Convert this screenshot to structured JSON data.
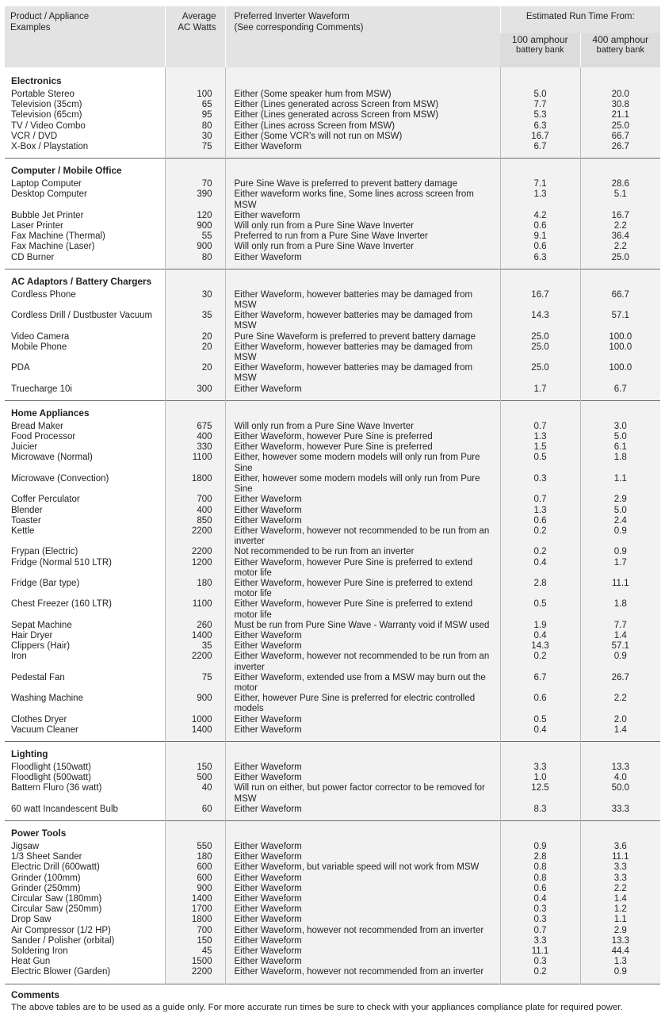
{
  "header": {
    "col_name_line1": "Product / Appliance",
    "col_name_line2": "Examples",
    "col_watts_line1": "Average",
    "col_watts_line2": "AC Watts",
    "col_wave_line1": "Preferred Inverter Waveform",
    "col_wave_line2": "(See corresponding Comments)",
    "runtime_group": "Estimated Run Time From:",
    "runtime_100_line1": "100 amphour",
    "runtime_100_line2": "battery bank",
    "runtime_400_line1": "400 amphour",
    "runtime_400_line2": "battery bank"
  },
  "comments": {
    "title": "Comments",
    "body": "The above tables are to be used as a guide only. For more accurate run times be sure to check with your appliances compliance plate for required power."
  },
  "chart_data": {
    "type": "table",
    "title": "Product / Appliance Examples",
    "columns": [
      "Product / Appliance Examples",
      "Average AC Watts",
      "Preferred Inverter Waveform (See corresponding Comments)",
      "100 amphour battery bank",
      "400 amphour battery bank"
    ],
    "sections": [
      {
        "name": "Electronics",
        "rows": [
          {
            "name": "Portable Stereo",
            "watts": "100",
            "waveform": "Either (Some speaker hum from MSW)",
            "r100": "5.0",
            "r400": "20.0"
          },
          {
            "name": "Television (35cm)",
            "watts": "65",
            "waveform": "Either (Lines generated across Screen from MSW)",
            "r100": "7.7",
            "r400": "30.8"
          },
          {
            "name": "Television (65cm)",
            "watts": "95",
            "waveform": "Either (Lines generated across Screen from MSW)",
            "r100": "5.3",
            "r400": "21.1"
          },
          {
            "name": "TV / Video Combo",
            "watts": "80",
            "waveform": "Either (Lines across Screen from MSW)",
            "r100": "6.3",
            "r400": "25.0"
          },
          {
            "name": "VCR / DVD",
            "watts": "30",
            "waveform": "Either (Some VCR's will not run on MSW)",
            "r100": "16.7",
            "r400": "66.7"
          },
          {
            "name": "X-Box / Playstation",
            "watts": "75",
            "waveform": "Either Waveform",
            "r100": "6.7",
            "r400": "26.7"
          }
        ]
      },
      {
        "name": "Computer / Mobile Office",
        "rows": [
          {
            "name": "Laptop Computer",
            "watts": "70",
            "waveform": "Pure Sine Wave is preferred to prevent battery damage",
            "r100": "7.1",
            "r400": "28.6"
          },
          {
            "name": "Desktop Computer",
            "watts": "390",
            "waveform": "Either waveform works fine, Some lines across screen from MSW",
            "r100": "1.3",
            "r400": "5.1"
          },
          {
            "name": "Bubble Jet Printer",
            "watts": "120",
            "waveform": "Either waveform",
            "r100": "4.2",
            "r400": "16.7"
          },
          {
            "name": "Laser Printer",
            "watts": "900",
            "waveform": "Will only run from a Pure Sine Wave Inverter",
            "r100": "0.6",
            "r400": "2.2"
          },
          {
            "name": "Fax Machine (Thermal)",
            "watts": "55",
            "waveform": "Preferred to run from a Pure Sine Wave Inverter",
            "r100": "9.1",
            "r400": "36.4"
          },
          {
            "name": "Fax Machine (Laser)",
            "watts": "900",
            "waveform": "Will only run from a Pure Sine Wave Inverter",
            "r100": "0.6",
            "r400": "2.2"
          },
          {
            "name": "CD Burner",
            "watts": "80",
            "waveform": "Either Waveform",
            "r100": "6.3",
            "r400": "25.0"
          }
        ]
      },
      {
        "name": "AC Adaptors / Battery Chargers",
        "rows": [
          {
            "name": "Cordless Phone",
            "watts": "30",
            "waveform": "Either Waveform, however batteries may be damaged from MSW",
            "r100": "16.7",
            "r400": "66.7"
          },
          {
            "name": "Cordless Drill / Dustbuster Vacuum",
            "watts": "35",
            "waveform": "Either Waveform, however batteries may be damaged from MSW",
            "r100": "14.3",
            "r400": "57.1"
          },
          {
            "name": "Video Camera",
            "watts": "20",
            "waveform": "Pure Sine Waveform is preferred to prevent battery damage",
            "r100": "25.0",
            "r400": "100.0"
          },
          {
            "name": "Mobile Phone",
            "watts": "20",
            "waveform": "Either Waveform, however batteries may be damaged from MSW",
            "r100": "25.0",
            "r400": "100.0"
          },
          {
            "name": "PDA",
            "watts": "20",
            "waveform": "Either Waveform, however batteries may be damaged from MSW",
            "r100": "25.0",
            "r400": "100.0"
          },
          {
            "name": "Truecharge 10i",
            "watts": "300",
            "waveform": "Either Waveform",
            "r100": "1.7",
            "r400": "6.7"
          }
        ]
      },
      {
        "name": "Home Appliances",
        "rows": [
          {
            "name": "Bread Maker",
            "watts": "675",
            "waveform": "Will only run from a Pure Sine Wave Inverter",
            "r100": "0.7",
            "r400": "3.0"
          },
          {
            "name": "Food Processor",
            "watts": "400",
            "waveform": "Either Waveform, however Pure Sine is preferred",
            "r100": "1.3",
            "r400": "5.0"
          },
          {
            "name": "Juicier",
            "watts": "330",
            "waveform": "Either Waveform, however Pure Sine is preferred",
            "r100": "1.5",
            "r400": "6.1"
          },
          {
            "name": "Microwave (Normal)",
            "watts": "1100",
            "waveform": "Either, however some modern models will only run from Pure Sine",
            "r100": "0.5",
            "r400": "1.8"
          },
          {
            "name": "Microwave (Convection)",
            "watts": "1800",
            "waveform": "Either, however some modern models will only run from Pure Sine",
            "r100": "0.3",
            "r400": "1.1"
          },
          {
            "name": "Coffer Perculator",
            "watts": "700",
            "waveform": "Either Waveform",
            "r100": "0.7",
            "r400": "2.9"
          },
          {
            "name": "Blender",
            "watts": "400",
            "waveform": "Either Waveform",
            "r100": "1.3",
            "r400": "5.0"
          },
          {
            "name": "Toaster",
            "watts": "850",
            "waveform": "Either Waveform",
            "r100": "0.6",
            "r400": "2.4"
          },
          {
            "name": "Kettle",
            "watts": "2200",
            "waveform": "Either Waveform, however not recommended to be run from an inverter",
            "r100": "0.2",
            "r400": "0.9"
          },
          {
            "name": "Frypan (Electric)",
            "watts": "2200",
            "waveform": "Not recommended to be run from an inverter",
            "r100": "0.2",
            "r400": "0.9"
          },
          {
            "name": "Fridge (Normal 510 LTR)",
            "watts": "1200",
            "waveform": "Either Waveform, however Pure Sine is preferred to extend motor life",
            "r100": "0.4",
            "r400": "1.7"
          },
          {
            "name": "Fridge (Bar type)",
            "watts": "180",
            "waveform": "Either Waveform, however Pure Sine is preferred to extend motor life",
            "r100": "2.8",
            "r400": "11.1"
          },
          {
            "name": "Chest Freezer (160 LTR)",
            "watts": "1100",
            "waveform": "Either Waveform, however Pure Sine is preferred to extend motor life",
            "r100": "0.5",
            "r400": "1.8"
          },
          {
            "name": "Sepat Machine",
            "watts": "260",
            "waveform": "Must be run from Pure Sine Wave - Warranty void if MSW used",
            "r100": "1.9",
            "r400": "7.7"
          },
          {
            "name": "Hair Dryer",
            "watts": "1400",
            "waveform": "Either Waveform",
            "r100": "0.4",
            "r400": "1.4"
          },
          {
            "name": "Clippers (Hair)",
            "watts": "35",
            "waveform": "Either Waveform",
            "r100": "14.3",
            "r400": "57.1"
          },
          {
            "name": "Iron",
            "watts": "2200",
            "waveform": "Either Waveform, however not recommended to be run from an inverter",
            "r100": "0.2",
            "r400": "0.9"
          },
          {
            "name": "Pedestal Fan",
            "watts": "75",
            "waveform": "Either Waveform, extended use from a MSW may burn out the motor",
            "r100": "6.7",
            "r400": "26.7"
          },
          {
            "name": "Washing Machine",
            "watts": "900",
            "waveform": "Either, however Pure Sine is preferred for electric controlled models",
            "r100": "0.6",
            "r400": "2.2"
          },
          {
            "name": "Clothes Dryer",
            "watts": "1000",
            "waveform": "Either Waveform",
            "r100": "0.5",
            "r400": "2.0"
          },
          {
            "name": "Vacuum Cleaner",
            "watts": "1400",
            "waveform": "Either Waveform",
            "r100": "0.4",
            "r400": "1.4"
          }
        ]
      },
      {
        "name": "Lighting",
        "rows": [
          {
            "name": "Floodlight (150watt)",
            "watts": "150",
            "waveform": "Either Waveform",
            "r100": "3.3",
            "r400": "13.3"
          },
          {
            "name": "Floodlight (500watt)",
            "watts": "500",
            "waveform": "Either Waveform",
            "r100": "1.0",
            "r400": "4.0"
          },
          {
            "name": "Battern Fluro (36 watt)",
            "watts": "40",
            "waveform": "Will run on either, but power factor corrector to be removed for MSW",
            "r100": "12.5",
            "r400": "50.0"
          },
          {
            "name": "60 watt Incandescent Bulb",
            "watts": "60",
            "waveform": "Either Waveform",
            "r100": "8.3",
            "r400": "33.3"
          }
        ]
      },
      {
        "name": "Power Tools",
        "rows": [
          {
            "name": "Jigsaw",
            "watts": "550",
            "waveform": "Either Waveform",
            "r100": "0.9",
            "r400": "3.6"
          },
          {
            "name": "1/3 Sheet Sander",
            "watts": "180",
            "waveform": "Either Waveform",
            "r100": "2.8",
            "r400": "11.1"
          },
          {
            "name": "Electric Drill (600watt)",
            "watts": "600",
            "waveform": "Either Waveform, but variable speed will not work from MSW",
            "r100": "0.8",
            "r400": "3.3"
          },
          {
            "name": "Grinder (100mm)",
            "watts": "600",
            "waveform": "Either Waveform",
            "r100": "0.8",
            "r400": "3.3"
          },
          {
            "name": "Grinder (250mm)",
            "watts": "900",
            "waveform": "Either Waveform",
            "r100": "0.6",
            "r400": "2.2"
          },
          {
            "name": "Circular Saw (180mm)",
            "watts": "1400",
            "waveform": "Either Waveform",
            "r100": "0.4",
            "r400": "1.4"
          },
          {
            "name": "Circular Saw (250mm)",
            "watts": "1700",
            "waveform": "Either Waveform",
            "r100": "0.3",
            "r400": "1.2"
          },
          {
            "name": "Drop Saw",
            "watts": "1800",
            "waveform": "Either Waveform",
            "r100": "0.3",
            "r400": "1.1"
          },
          {
            "name": "Air Compressor (1/2 HP)",
            "watts": "700",
            "waveform": "Either Waveform, however not recommended from an inverter",
            "r100": "0.7",
            "r400": "2.9"
          },
          {
            "name": "Sander / Polisher (orbital)",
            "watts": "150",
            "waveform": "Either Waveform",
            "r100": "3.3",
            "r400": "13.3"
          },
          {
            "name": "Soldering Iron",
            "watts": "45",
            "waveform": "Either Waveform",
            "r100": "11.1",
            "r400": "44.4"
          },
          {
            "name": "Heat Gun",
            "watts": "1500",
            "waveform": "Either Waveform",
            "r100": "0.3",
            "r400": "1.3"
          },
          {
            "name": "Electric Blower (Garden)",
            "watts": "2200",
            "waveform": "Either Waveform, however not recommended from an inverter",
            "r100": "0.2",
            "r400": "0.9"
          }
        ]
      }
    ]
  }
}
